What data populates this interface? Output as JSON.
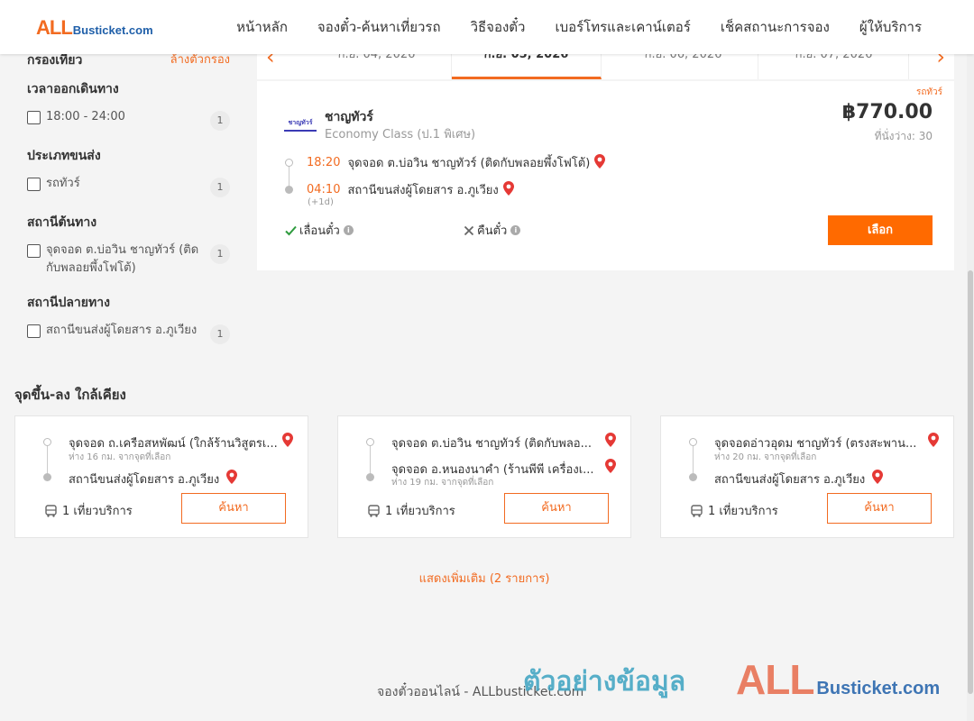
{
  "header": {
    "logo_all": "ALL",
    "logo_rest": "Busticket.com",
    "nav": [
      "หน้าหลัก",
      "จองตั๋ว-ค้นหาเที่ยวรถ",
      "วิธีจองตั๋ว",
      "เบอร์โทรและเคาน์เตอร์",
      "เช็คสถานะการจอง",
      "ผู้ให้บริการ"
    ]
  },
  "filters": {
    "title": "กรองเที่ยว",
    "clear_label": "ล้างตัวกรอง",
    "groups": [
      {
        "title": "เวลาออกเดินทาง",
        "option": "18:00 - 24:00",
        "count": "1"
      },
      {
        "title": "ประเภทขนส่ง",
        "option": "รถทัวร์",
        "count": "1"
      },
      {
        "title": "สถานีต้นทาง",
        "option": "จุดจอด ต.บ่อวิน ชาญทัวร์ (ติดกับพลอยพึ้งโฟโต้)",
        "count": "1"
      },
      {
        "title": "สถานีปลายทาง",
        "option": "สถานีขนส่งผู้โดยสาร อ.ภูเวียง",
        "count": "1"
      }
    ]
  },
  "dates": {
    "tabs": [
      "ก.ย. 04, 2026",
      "ก.ย. 05, 2026",
      "ก.ย. 06, 2026",
      "ก.ย. 07, 2026"
    ],
    "active_index": 1,
    "prev_icon": "‹",
    "next_icon": "›"
  },
  "trip": {
    "type_label": "รถทัวร์",
    "logo_text": "ชาญทัวร์",
    "operator": "ชาญทัวร์",
    "bus_class": "Economy Class (ป.1 พิเศษ)",
    "price": "฿770.00",
    "seats": "ที่นั่งว่าง: 30",
    "depart_time": "18:20",
    "depart_station": "จุดจอด ต.บ่อวิน ชาญทัวร์ (ติดกับพลอยพึ้งโฟโต้)",
    "arrive_time": "04:10",
    "arrive_station": "สถานีขนส่งผู้โดยสาร อ.ภูเวียง",
    "next_day": "(+1d)",
    "reschedule_label": "เลื่อนตั๋ว",
    "refund_label": "คืนตั๋ว",
    "select_label": "เลือก"
  },
  "nearby": {
    "title": "จุดขึ้น-ลง ใกล้เคียง",
    "cards": [
      {
        "from": "จุดจอด ถ.เครือสหพัฒน์ (ใกล้ร้านวิสูตรเ...",
        "from_dist": "ห่าง 16 กม. จากจุดที่เลือก",
        "to": "สถานีขนส่งผู้โดยสาร อ.ภูเวียง",
        "to_dist": "",
        "trips": "1 เที่ยวบริการ",
        "button": "ค้นหา"
      },
      {
        "from": "จุดจอด ต.บ่อวิน ชาญทัวร์ (ติดกับพลอ...",
        "from_dist": "",
        "to": "จุดจอด อ.หนองนาคำ (ร้านพีพี เครื่องเ...",
        "to_dist": "ห่าง 19 กม. จากจุดที่เลือก",
        "trips": "1 เที่ยวบริการ",
        "button": "ค้นหา"
      },
      {
        "from": "จุดจอดอ่าวอุดม ชาญทัวร์ (ตรงสะพาน...",
        "from_dist": "ห่าง 20 กม. จากจุดที่เลือก",
        "to": "สถานีขนส่งผู้โดยสาร อ.ภูเวียง",
        "to_dist": "",
        "trips": "1 เที่ยวบริการ",
        "button": "ค้นหา"
      }
    ],
    "show_more": "แสดงเพิ่มเติม (2 รายการ)"
  },
  "footer": {
    "text": "จองตั๋วออนไลน์ - ALLbusticket.com"
  },
  "watermark": {
    "thai": "ตัวอย่างข้อมูล",
    "logo_all": "ALL",
    "logo_rest": "Busticket.com"
  },
  "colors": {
    "accent": "#f26b21",
    "button": "#ff6a00",
    "pin": "#e53935"
  }
}
